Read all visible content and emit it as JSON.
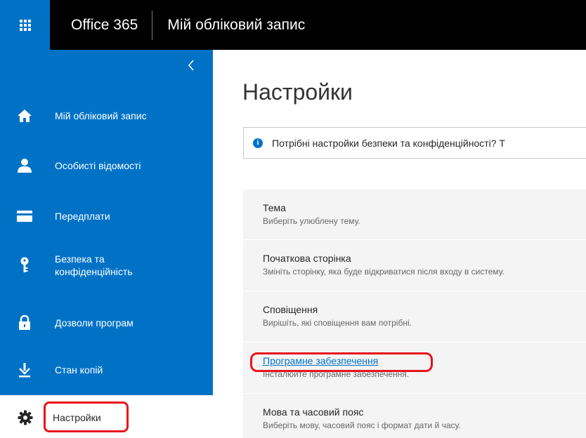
{
  "topbar": {
    "brand": "Office 365",
    "app_title": "Мій обліковий запис",
    "waffle_icon": "app-launcher-icon"
  },
  "sidebar": {
    "collapse_icon": "chevron-left-icon",
    "items": [
      {
        "label": "Мій обліковий запис",
        "icon": "home-icon"
      },
      {
        "label": "Особисті відомості",
        "icon": "person-icon"
      },
      {
        "label": "Передплати",
        "icon": "card-icon"
      },
      {
        "label": "Безпека та\nконфіденційність",
        "icon": "key-icon"
      },
      {
        "label": "Дозволи програм",
        "icon": "lock-icon"
      },
      {
        "label": "Стан копій",
        "icon": "download-icon"
      },
      {
        "label": "Настройки",
        "icon": "gear-icon"
      }
    ]
  },
  "main": {
    "title": "Настройки",
    "notice": "Потрібні настройки безпеки та конфіденційності? Т",
    "settings": [
      {
        "title": "Тема",
        "desc": "Виберіть улюблену тему."
      },
      {
        "title": "Початкова сторінка",
        "desc": "Змініть сторінку, яка буде відкриватися після входу в систему."
      },
      {
        "title": "Сповіщення",
        "desc": "Вирішіть, які сповіщення вам потрібні."
      },
      {
        "title": "Програмне забезпечення",
        "desc": "Інсталюйте програмне забезпечення."
      },
      {
        "title": "Мова та часовий пояс",
        "desc": "Виберіть мову, часовий пояс і формат дати й часу."
      }
    ]
  },
  "colors": {
    "brand_blue": "#0072c6",
    "topbar": "#000000",
    "highlight_red": "#e8141b",
    "list_bg": "#f4f4f4"
  }
}
